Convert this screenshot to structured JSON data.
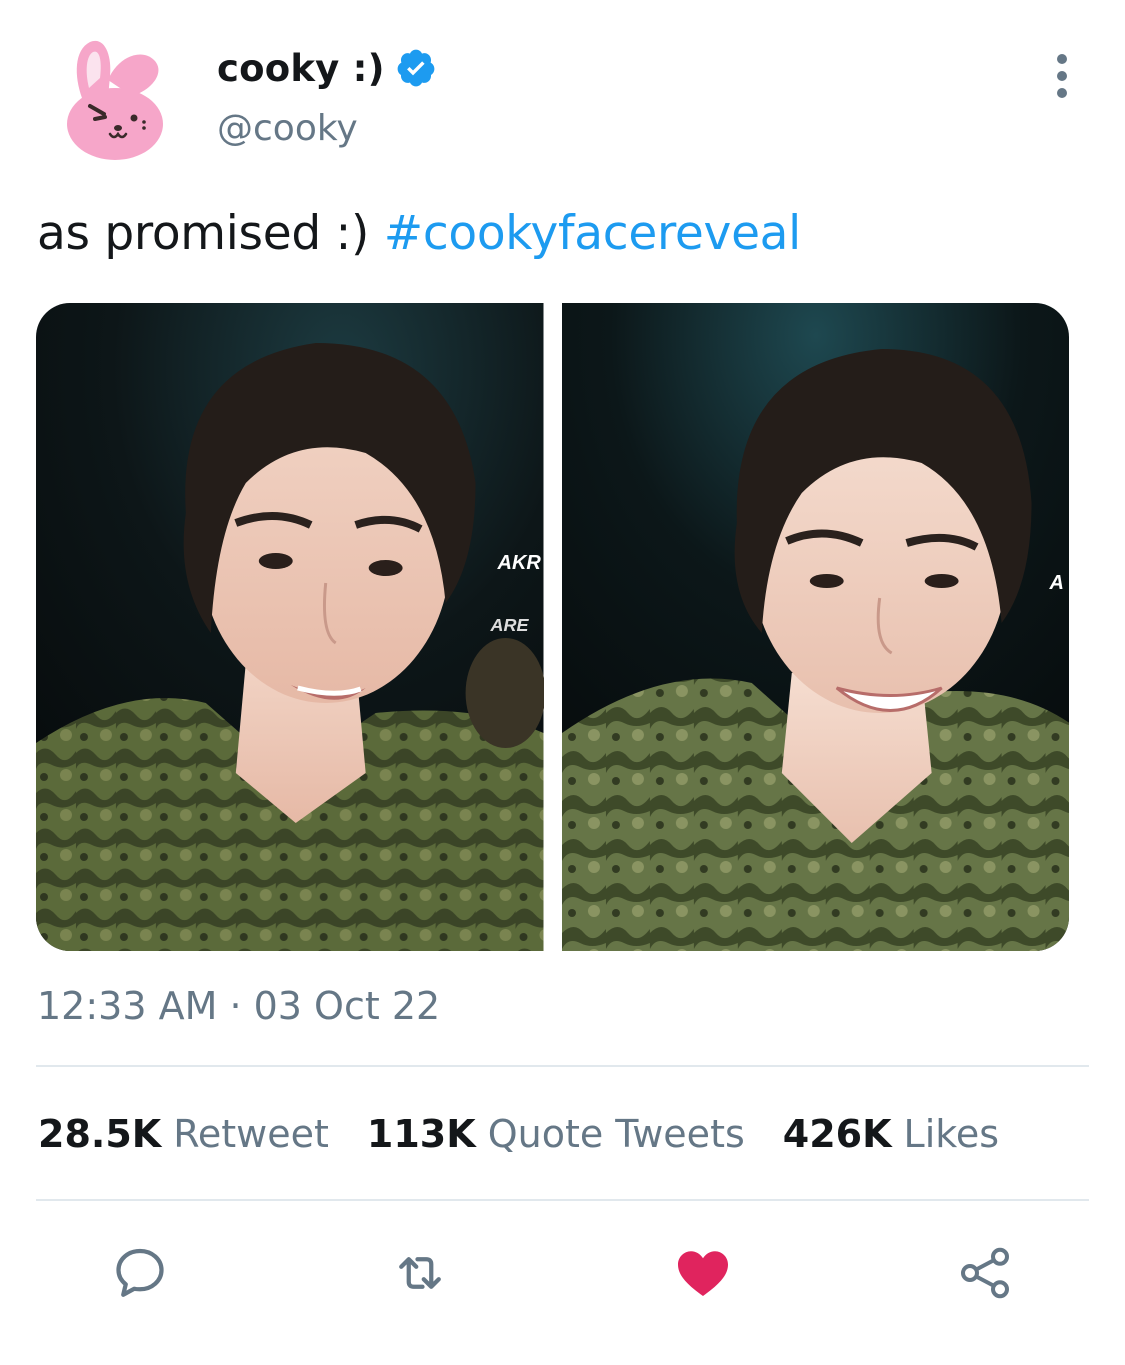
{
  "user": {
    "display_name": "cooky :)",
    "handle": "@cooky",
    "verified_icon": "verified-badge-icon",
    "avatar": "cooky-bunny-avatar"
  },
  "tweet": {
    "text": "as promised :) ",
    "hashtag": "#cookyfacereveal",
    "timestamp": "12:33 AM · 03 Oct 22",
    "photos": [
      {
        "overlay_text_top": "AKR",
        "overlay_text_bottom": "ARE"
      },
      {
        "overlay_text_top": "A",
        "overlay_text_bottom": ""
      }
    ]
  },
  "stats": {
    "retweets_count": "28.5K",
    "retweets_label": "Retweet",
    "quotes_count": "113K",
    "quotes_label": "Quote Tweets",
    "likes_count": "426K",
    "likes_label": "Likes"
  },
  "actions": {
    "reply_icon": "reply-icon",
    "retweet_icon": "retweet-icon",
    "like_icon": "heart-icon",
    "share_icon": "share-icon"
  },
  "colors": {
    "accent": "#1d9bf0",
    "like": "#e0245e",
    "secondary_text": "#657786",
    "avatar_pink": "#f6a6c9"
  }
}
